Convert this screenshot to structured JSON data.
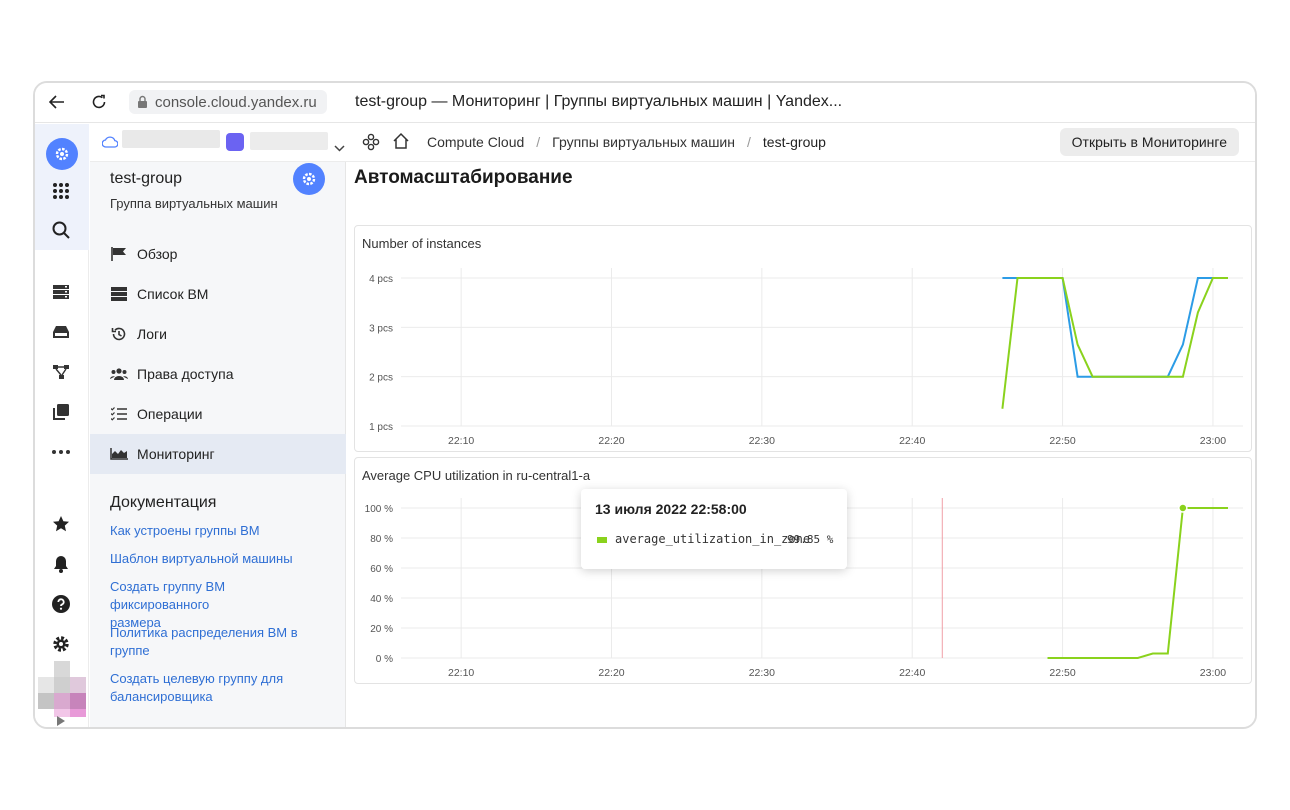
{
  "browser": {
    "url": "console.cloud.yandex.ru",
    "title": "test-group — Мониторинг | Группы виртуальных машин | Yandex..."
  },
  "header": {
    "breadcrumbs": [
      "Compute Cloud",
      "Группы виртуальных машин",
      "test-group"
    ],
    "separator": "/",
    "open_button": "Открыть в Мониторинге"
  },
  "sidebar": {
    "title": "test-group",
    "subtitle": "Группа виртуальных машин",
    "items": [
      {
        "label": "Обзор",
        "icon": "flag-icon"
      },
      {
        "label": "Список ВМ",
        "icon": "server-list-icon"
      },
      {
        "label": "Логи",
        "icon": "history-icon"
      },
      {
        "label": "Права доступа",
        "icon": "users-icon"
      },
      {
        "label": "Операции",
        "icon": "checklist-icon"
      },
      {
        "label": "Мониторинг",
        "icon": "chart-area-icon",
        "active": true
      }
    ],
    "docs_title": "Документация",
    "docs": [
      "Как устроены группы ВМ",
      "Шаблон виртуальной машины",
      "Создать группу ВМ фиксированного размера",
      "Политика распределения ВМ в группе",
      "Создать целевую группу для балансировщика"
    ]
  },
  "main": {
    "title": "Автомасштабирование"
  },
  "colors": {
    "accent": "#5282ff",
    "series_blue": "#2c9ce6",
    "series_green": "#8ad21d",
    "link": "#2f6fd4"
  },
  "chart_data": [
    {
      "type": "line",
      "title": "Number of instances",
      "x_ticks": [
        "22:10",
        "22:20",
        "22:30",
        "22:40",
        "22:50",
        "23:00"
      ],
      "y_ticks": [
        "1 pcs",
        "2 pcs",
        "3 pcs",
        "4 pcs"
      ],
      "ylim": [
        1,
        4
      ],
      "xlim": [
        "22:06",
        "23:02"
      ],
      "grid": true,
      "series": [
        {
          "color": "#2c9ce6",
          "points": [
            [
              "22:46",
              4
            ],
            [
              "22:50",
              4
            ],
            [
              "22:51",
              2
            ],
            [
              "22:57",
              2
            ],
            [
              "22:58",
              2.65
            ],
            [
              "22:59",
              4
            ],
            [
              "23:00",
              4
            ]
          ]
        },
        {
          "color": "#8ad21d",
          "points": [
            [
              "22:46",
              1.35
            ],
            [
              "22:47",
              4
            ],
            [
              "22:50",
              4
            ],
            [
              "22:51",
              2.65
            ],
            [
              "22:52",
              2
            ],
            [
              "22:58",
              2
            ],
            [
              "22:59",
              3.3
            ],
            [
              "23:00",
              4
            ],
            [
              "23:01",
              4
            ]
          ]
        }
      ]
    },
    {
      "type": "line",
      "title": "Average CPU utilization in ru-central1-a",
      "x_ticks": [
        "22:10",
        "22:20",
        "22:30",
        "22:40",
        "22:50",
        "23:00"
      ],
      "y_ticks": [
        "0 %",
        "20 %",
        "40 %",
        "60 %",
        "80 %",
        "100 %"
      ],
      "ylim": [
        0,
        100
      ],
      "xlim": [
        "22:06",
        "23:02"
      ],
      "grid": true,
      "series": [
        {
          "name": "average_utilization_in_zone",
          "color": "#8ad21d",
          "points": [
            [
              "22:49",
              0
            ],
            [
              "22:55",
              0
            ],
            [
              "22:56",
              3
            ],
            [
              "22:57",
              3
            ],
            [
              "22:58",
              100
            ],
            [
              "23:01",
              100
            ]
          ]
        }
      ],
      "cursor_time": "22:42",
      "tooltip": {
        "title": "13 июля 2022 22:58:00",
        "series": "average_utilization_in_zone",
        "value": "99.85 %"
      }
    }
  ]
}
